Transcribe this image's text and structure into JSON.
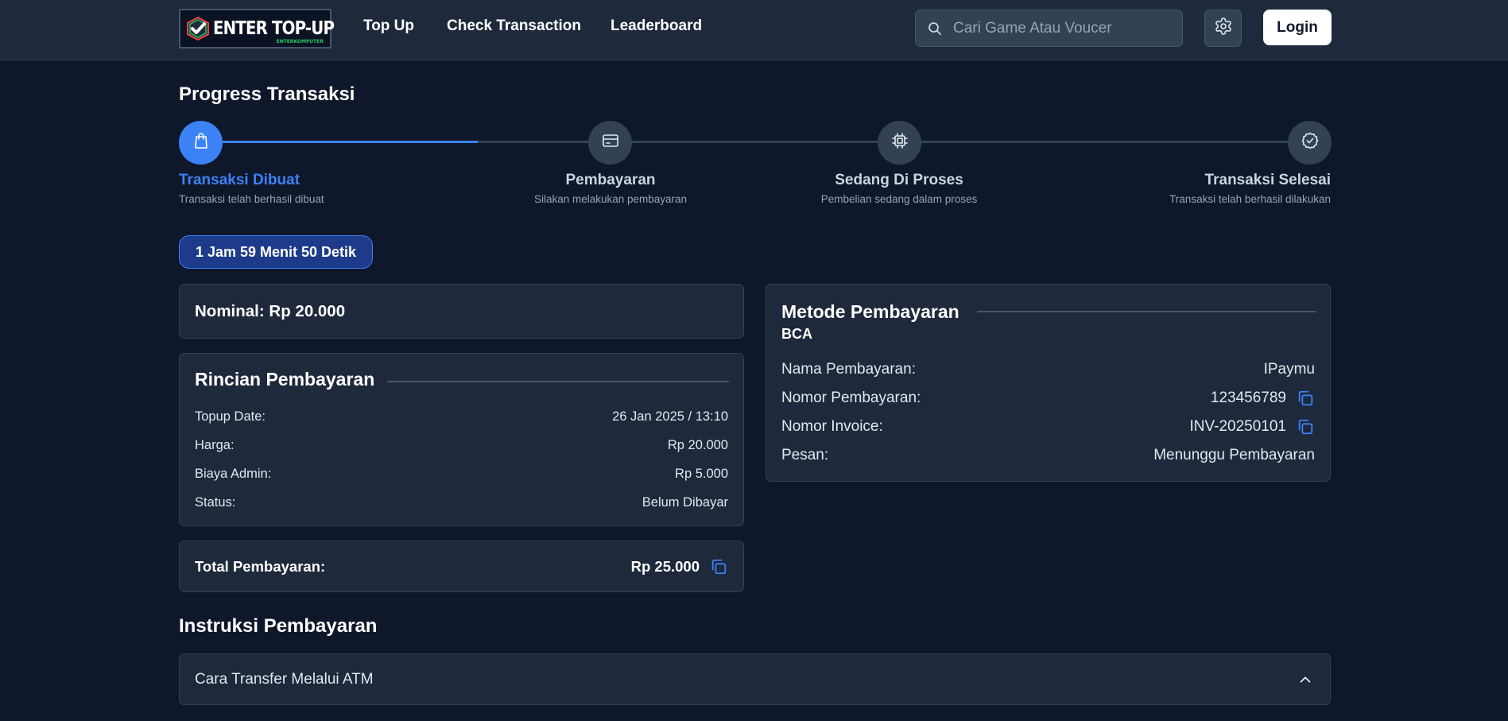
{
  "header": {
    "logo_text": "ENTER TOP-UP",
    "logo_subtext": "ENTERKOMPUTER",
    "nav": [
      "Top Up",
      "Check Transaction",
      "Leaderboard"
    ],
    "search_placeholder": "Cari Game Atau Voucer",
    "login_label": "Login"
  },
  "progress": {
    "title": "Progress Transaksi",
    "fill_fraction": 0.25,
    "steps": [
      {
        "title": "Transaksi Dibuat",
        "desc": "Transaksi telah berhasil dibuat",
        "icon": "shopping-bag-icon",
        "active": true
      },
      {
        "title": "Pembayaran",
        "desc": "Silakan melakukan pembayaran",
        "icon": "credit-card-icon",
        "active": false
      },
      {
        "title": "Sedang Di Proses",
        "desc": "Pembelian sedang dalam proses",
        "icon": "cpu-icon",
        "active": false
      },
      {
        "title": "Transaksi Selesai",
        "desc": "Transaksi telah berhasil dilakukan",
        "icon": "check-circle-icon",
        "active": false
      }
    ]
  },
  "timer": "1 Jam 59 Menit 50 Detik",
  "nominal": "Nominal: Rp 20.000",
  "rincian": {
    "title": "Rincian Pembayaran",
    "rows": [
      {
        "label": "Topup Date:",
        "value": "26 Jan 2025 / 13:10"
      },
      {
        "label": "Harga:",
        "value": "Rp 20.000"
      },
      {
        "label": "Biaya Admin:",
        "value": "Rp 5.000"
      },
      {
        "label": "Status:",
        "value": "Belum Dibayar"
      }
    ]
  },
  "total": {
    "label": "Total Pembayaran:",
    "value": "Rp 25.000"
  },
  "metode": {
    "title": "Metode Pembayaran",
    "bank": "BCA",
    "rows": [
      {
        "label": "Nama Pembayaran:",
        "value": "IPaymu"
      },
      {
        "label": "Nomor Pembayaran:",
        "value": "123456789"
      },
      {
        "label": "Nomor Invoice:",
        "value": "INV-20250101"
      },
      {
        "label": "Pesan:",
        "value": "Menunggu Pembayaran"
      }
    ]
  },
  "instruksi": {
    "title": "Instruksi Pembayaran",
    "item": "Cara Transfer Melalui ATM"
  },
  "colors": {
    "background": "#0f172a",
    "card": "#1e293b",
    "accent": "#3b82f6",
    "inactive": "#334155"
  }
}
